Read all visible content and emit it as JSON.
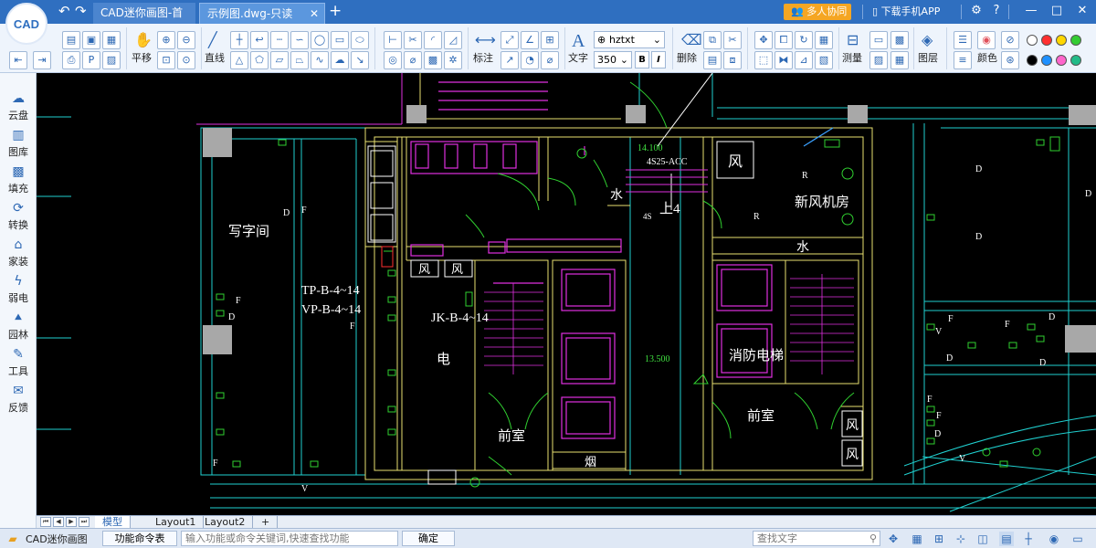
{
  "titlebar": {
    "logo": "CAD",
    "back_icon": "↶",
    "forward_icon": "↷",
    "tabs": [
      {
        "label": "CAD迷你画图-首页"
      },
      {
        "label": "示例图.dwg-只读",
        "close": "✕"
      }
    ],
    "add_tab": "+",
    "collab_label": "多人协同",
    "mobile_label": "下载手机APP",
    "colors": {
      "bar": "#2f6fc0",
      "accent": "#f5a623"
    }
  },
  "ribbon": {
    "pan_label": "平移",
    "line_label": "直线",
    "dim_label": "标注",
    "text_label": "文字",
    "font_value": "hztxt",
    "font_size_value": "350",
    "bold": "B",
    "italic": "I",
    "delete_label": "删除",
    "measure_label": "测量",
    "layer_label": "图层",
    "color_label": "颜色",
    "swatches": [
      "#ffffff",
      "#ff3030",
      "#ffd700",
      "#33cc33",
      "#000000",
      "#1e90ff",
      "#ff66cc",
      "#22bb88"
    ]
  },
  "sidebar": {
    "items": [
      {
        "label": "云盘",
        "icon": "cloud-icon"
      },
      {
        "label": "图库",
        "icon": "gallery-icon"
      },
      {
        "label": "填充",
        "icon": "fill-icon"
      },
      {
        "label": "转换",
        "icon": "convert-icon"
      },
      {
        "label": "家装",
        "icon": "home-icon"
      },
      {
        "label": "弱电",
        "icon": "lightning-icon"
      },
      {
        "label": "园林",
        "icon": "tree-icon"
      },
      {
        "label": "工具",
        "icon": "tools-icon"
      },
      {
        "label": "反馈",
        "icon": "mail-icon"
      }
    ]
  },
  "drawing": {
    "labels": {
      "office": "写字间",
      "tp": "TP-B-4~14",
      "vp": "VP-B-4~14",
      "jk": "JK-B-4~14",
      "elec": "电",
      "front1": "前室",
      "front2": "前室",
      "smoke": "烟",
      "water1": "水",
      "water2": "水",
      "up4": "上4",
      "fresh_air": "新风机房",
      "fire_elevator": "消防电梯",
      "wind1": "风",
      "wind2": "风",
      "wind3": "风",
      "wind4": "风",
      "wind5": "风",
      "elev_mark": "14.100",
      "acc": "4S25-ACC",
      "s4": "4S",
      "elev_mark2": "13.500",
      "d": "D",
      "f": "F",
      "r": "R",
      "v": "V"
    }
  },
  "layouts": {
    "tabs": [
      "模型",
      "Layout1",
      "Layout2"
    ],
    "add": "+"
  },
  "status": {
    "app_name": "CAD迷你画图",
    "cmd_button": "功能命令表",
    "cmd_placeholder": "输入功能或命令关键词,快速查找功能",
    "confirm": "确定",
    "find_text": "查找文字"
  }
}
